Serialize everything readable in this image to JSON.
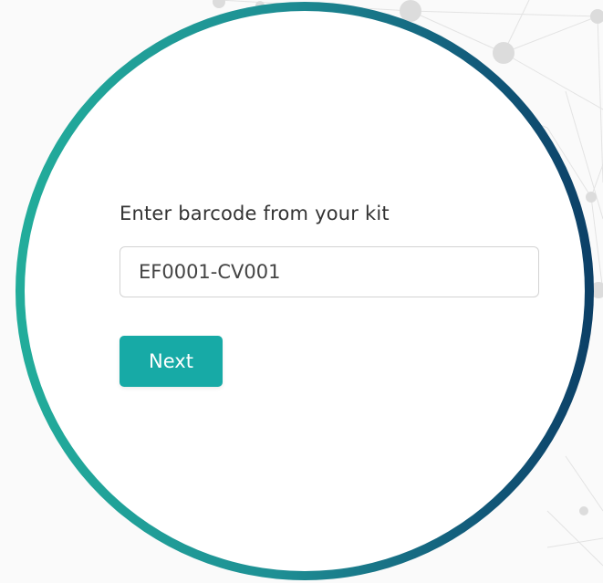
{
  "form": {
    "barcode_label": "Enter barcode from your kit",
    "barcode_value": "EF0001-CV001",
    "next_label": "Next"
  },
  "colors": {
    "accent": "#17aaa6",
    "ring_start": "#22ad9b",
    "ring_end": "#0c3f66"
  }
}
